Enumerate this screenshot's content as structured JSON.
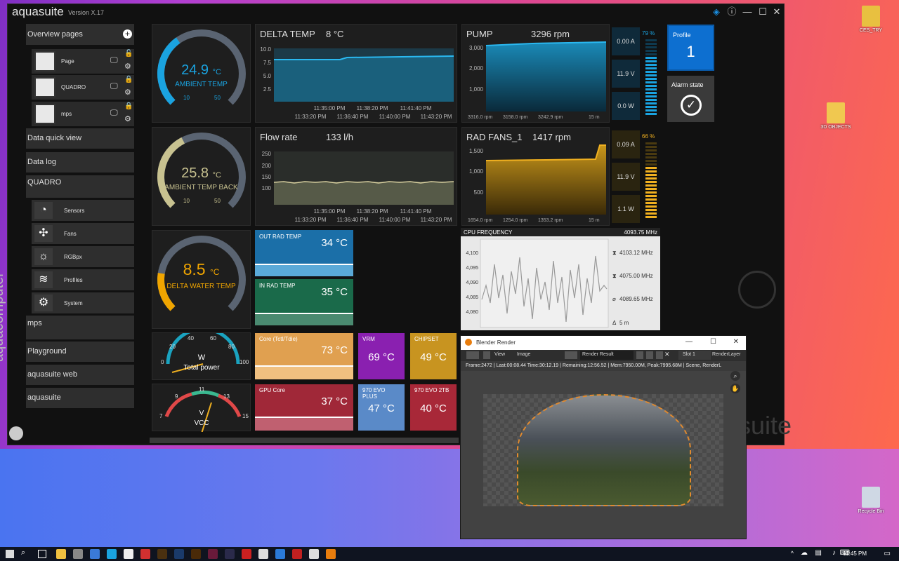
{
  "app": {
    "name": "aquasuite",
    "version": "Version X.17",
    "brand_vertical": "aquacomputer",
    "watermark": "suite"
  },
  "sidebar": {
    "overview": "Overview pages",
    "pages": [
      {
        "label": "Page"
      },
      {
        "label": "QUADRO"
      },
      {
        "label": "mps"
      }
    ],
    "data_quick_view": "Data quick view",
    "data_log": "Data log",
    "quadro": "QUADRO",
    "quadro_items": [
      {
        "label": "Sensors",
        "icon": "gauge-icon"
      },
      {
        "label": "Fans",
        "icon": "fan-icon"
      },
      {
        "label": "RGBpx",
        "icon": "bulb-icon"
      },
      {
        "label": "Profiles",
        "icon": "layers-icon"
      },
      {
        "label": "System",
        "icon": "gear-icon"
      }
    ],
    "mps": "mps",
    "playground": "Playground",
    "aquasuite_web": "aquasuite web",
    "aquasuite": "aquasuite"
  },
  "gauges": {
    "ambient": {
      "value": "24.9",
      "unit": "°C",
      "label": "AMBIENT TEMP",
      "min": "10",
      "max": "50",
      "level": 0.37,
      "color": "#1aa3e0"
    },
    "ambient_back": {
      "value": "25.8",
      "unit": "°C",
      "label": "AMBIENT TEMP BACK",
      "min": "10",
      "max": "50",
      "level": 0.4,
      "color": "#c8c290"
    },
    "delta_water": {
      "value": "8.5",
      "unit": "°C",
      "label": "DELTA WATER TEMP",
      "level": 0.2,
      "color": "#f0a500"
    }
  },
  "delta_temp": {
    "title": "DELTA TEMP",
    "value": "8 °C",
    "yticks": [
      "10.0",
      "7.5",
      "5.0",
      "2.5"
    ],
    "xticks_top": [
      "11:35:00 PM",
      "11:38:20 PM",
      "11:41:40 PM"
    ],
    "xticks_bottom": [
      "11:33:20 PM",
      "11:36:40 PM",
      "11:40:00 PM",
      "11:43:20 PM"
    ]
  },
  "flow_rate": {
    "title": "Flow rate",
    "value": "133 l/h",
    "yticks": [
      "250",
      "200",
      "150",
      "100"
    ],
    "xticks_top": [
      "11:35:00 PM",
      "11:38:20 PM",
      "11:41:40 PM"
    ],
    "xticks_bottom": [
      "11:33:20 PM",
      "11:36:40 PM",
      "11:40:00 PM",
      "11:43:20 PM"
    ]
  },
  "pump": {
    "title": "PUMP",
    "value": "3296 rpm",
    "yticks": [
      "3,000",
      "2,000",
      "1,000"
    ],
    "stats": [
      "3316.0 rpm",
      "3158.0 rpm",
      "3242.9 rpm",
      "15 m"
    ],
    "amp": "0.00 A",
    "volt": "11.9 V",
    "watt": "0.0 W",
    "percent": "79 %",
    "level": 0.79
  },
  "rad_fans": {
    "title": "RAD FANS_1",
    "value": "1417 rpm",
    "yticks": [
      "1,500",
      "1,000",
      "500"
    ],
    "stats": [
      "1654.0 rpm",
      "1254.0 rpm",
      "1353.2 rpm",
      "15 m"
    ],
    "amp": "0.09 A",
    "volt": "11.9 V",
    "watt": "1.1 W",
    "percent": "66 %",
    "level": 0.66
  },
  "profile": {
    "label": "Profile",
    "value": "1"
  },
  "alarm": {
    "label": "Alarm state"
  },
  "cpu_freq": {
    "title": "CPU FREQUENCY",
    "value": "4093.75 MHz",
    "yticks": [
      "4,100",
      "4,095",
      "4,090",
      "4,085",
      "4,080"
    ],
    "max": "4103.12 MHz",
    "min": "4075.00 MHz",
    "avg": "4089.65 MHz",
    "span": "5 m"
  },
  "out_rad": {
    "title": "OUT RAD TEMP",
    "value": "34 °C"
  },
  "in_rad": {
    "title": "IN RAD TEMP",
    "value": "35 °C"
  },
  "core": {
    "title": "Core (Tctl/Tdie)",
    "value": "73 °C"
  },
  "vrm": {
    "title": "VRM",
    "value": "69 °C"
  },
  "chipset": {
    "title": "CHIPSET",
    "value": "49 °C"
  },
  "gpu_core": {
    "title": "GPU Core",
    "value": "37 °C"
  },
  "evo_plus": {
    "title": "970 EVO PLUS",
    "value": "47 °C"
  },
  "evo_2tb": {
    "title": "970 EVO 2TB",
    "value": "40 °C"
  },
  "power_gauge": {
    "unit": "W",
    "label": "Total power",
    "ticks": [
      "0",
      "20",
      "40",
      "60",
      "80",
      "100"
    ],
    "level": 0.05
  },
  "volt_gauge": {
    "unit": "V",
    "label": "VCC",
    "ticks": [
      "7",
      "9",
      "11",
      "13",
      "15"
    ],
    "level": 0.56
  },
  "blender": {
    "title": "Blender Render",
    "menu": [
      "View",
      "Image"
    ],
    "result": "Render Result",
    "slot": "Slot 1",
    "layer": "RenderLayer",
    "status": "Frame:2472 | Last:00:08.44 Time:30:12.19 | Remaining:12:56.52 | Mem:7950.00M, Peak:7995.68M | Scene, RenderL"
  },
  "desktop": {
    "icons": [
      "CES_TRY",
      "3D OBJECTS",
      "Recycle Bin"
    ]
  },
  "taskbar": {
    "clock": "11:45 PM"
  }
}
